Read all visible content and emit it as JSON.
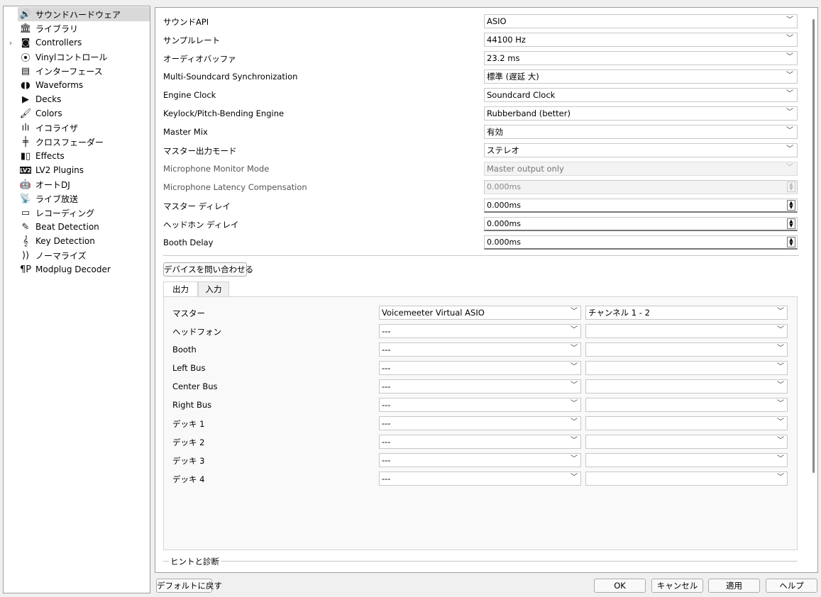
{
  "sidebar": {
    "items": [
      {
        "label": "サウンドハードウェア",
        "icon": "speaker-icon",
        "glyph": "🔊",
        "selected": true
      },
      {
        "label": "ライブラリ",
        "icon": "library-icon",
        "glyph": "🏛"
      },
      {
        "label": "Controllers",
        "icon": "controller-icon",
        "glyph": "◙",
        "expand": "›"
      },
      {
        "label": "Vinylコントロール",
        "icon": "vinyl-icon",
        "glyph": "⦿"
      },
      {
        "label": "インターフェース",
        "icon": "interface-icon",
        "glyph": "▤"
      },
      {
        "label": "Waveforms",
        "icon": "waveform-icon",
        "glyph": "◖◗"
      },
      {
        "label": "Decks",
        "icon": "decks-icon",
        "glyph": "▶"
      },
      {
        "label": "Colors",
        "icon": "colors-icon",
        "glyph": "🖌"
      },
      {
        "label": "イコライザ",
        "icon": "equalizer-icon",
        "glyph": "ılı"
      },
      {
        "label": "クロスフェーダー",
        "icon": "crossfader-icon",
        "glyph": "╪"
      },
      {
        "label": "Effects",
        "icon": "effects-icon",
        "glyph": "▮▯"
      },
      {
        "label": "LV2 Plugins",
        "icon": "lv2-icon",
        "glyph": "LV2"
      },
      {
        "label": "オートDJ",
        "icon": "android-icon",
        "glyph": "🤖"
      },
      {
        "label": "ライブ放送",
        "icon": "broadcast-icon",
        "glyph": "📡"
      },
      {
        "label": "レコーディング",
        "icon": "recording-icon",
        "glyph": "▭"
      },
      {
        "label": "Beat Detection",
        "icon": "beat-icon",
        "glyph": "✎"
      },
      {
        "label": "Key Detection",
        "icon": "key-icon",
        "glyph": "𝄞"
      },
      {
        "label": "ノーマライズ",
        "icon": "normalize-icon",
        "glyph": "))"
      },
      {
        "label": "Modplug Decoder",
        "icon": "modplug-icon",
        "glyph": "¶P"
      }
    ]
  },
  "settings": [
    {
      "label": "サウンドAPI",
      "value": "ASIO",
      "kind": "combo"
    },
    {
      "label": "サンプルレート",
      "value": "44100 Hz",
      "kind": "combo"
    },
    {
      "label": "オーディオバッファ",
      "value": "23.2 ms",
      "kind": "combo"
    },
    {
      "label": "Multi-Soundcard Synchronization",
      "value": "標準 (遅延 大)",
      "kind": "combo"
    },
    {
      "label": "Engine Clock",
      "value": "Soundcard Clock",
      "kind": "combo"
    },
    {
      "label": "Keylock/Pitch-Bending Engine",
      "value": "Rubberband (better)",
      "kind": "combo"
    },
    {
      "label": "Master Mix",
      "value": "有効",
      "kind": "combo"
    },
    {
      "label": "マスター出力モード",
      "value": "ステレオ",
      "kind": "combo"
    },
    {
      "label": "Microphone Monitor Mode",
      "value": "Master output only",
      "kind": "combo",
      "disabled": true
    },
    {
      "label": "Microphone Latency Compensation",
      "value": "0.000ms",
      "kind": "spin",
      "disabled": true
    },
    {
      "label": "マスター ディレイ",
      "value": "0.000ms",
      "kind": "spin"
    },
    {
      "label": "ヘッドホン ディレイ",
      "value": "0.000ms",
      "kind": "spin"
    },
    {
      "label": "Booth Delay",
      "value": "0.000ms",
      "kind": "spin"
    }
  ],
  "query_button": "デバイスを問い合わせる",
  "tabs": [
    "出力",
    "入力"
  ],
  "outputs": [
    {
      "label": "マスター",
      "device": "Voicemeeter Virtual ASIO",
      "channel": "チャンネル 1 - 2"
    },
    {
      "label": "ヘッドフォン",
      "device": "---",
      "channel": ""
    },
    {
      "label": "Booth",
      "device": "---",
      "channel": ""
    },
    {
      "label": "Left Bus",
      "device": "---",
      "channel": ""
    },
    {
      "label": "Center Bus",
      "device": "---",
      "channel": ""
    },
    {
      "label": "Right Bus",
      "device": "---",
      "channel": ""
    },
    {
      "label": "デッキ 1",
      "device": "---",
      "channel": ""
    },
    {
      "label": "デッキ 2",
      "device": "---",
      "channel": ""
    },
    {
      "label": "デッキ 3",
      "device": "---",
      "channel": ""
    },
    {
      "label": "デッキ 4",
      "device": "---",
      "channel": ""
    }
  ],
  "hints_title": "ヒントと診断",
  "buttons": {
    "defaults": "デフォルトに戻す",
    "ok": "OK",
    "cancel": "キャンセル",
    "apply": "適用",
    "help": "ヘルプ"
  }
}
